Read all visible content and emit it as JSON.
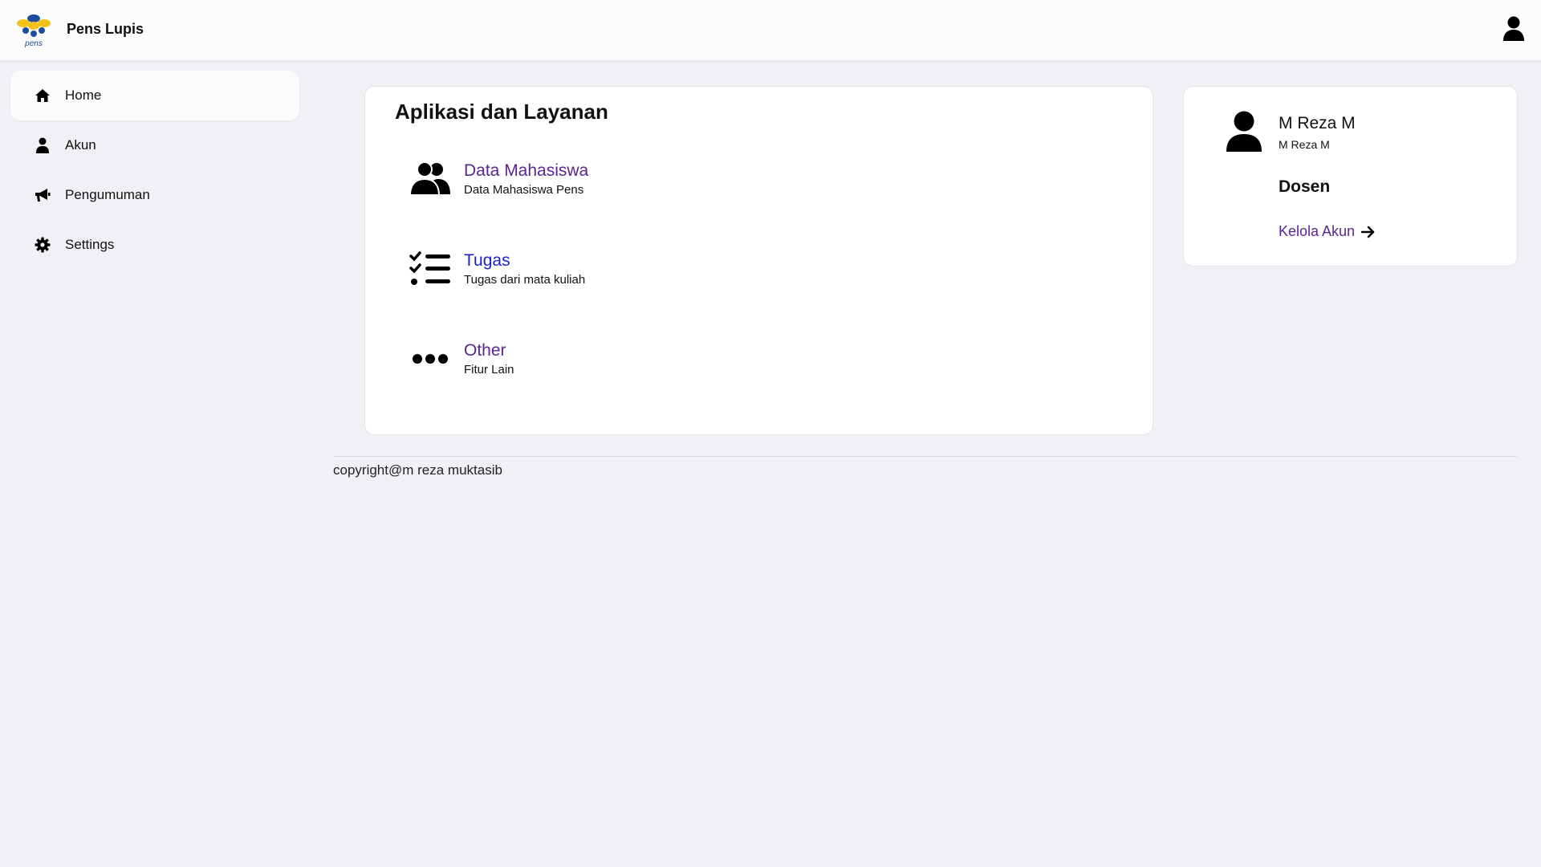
{
  "header": {
    "brand": "Pens Lupis",
    "logo_text": "pens"
  },
  "sidebar": {
    "items": [
      {
        "label": "Home",
        "icon": "home-icon",
        "active": true
      },
      {
        "label": "Akun",
        "icon": "user-icon",
        "active": false
      },
      {
        "label": "Pengumuman",
        "icon": "megaphone-icon",
        "active": false
      },
      {
        "label": "Settings",
        "icon": "gear-icon",
        "active": false
      }
    ]
  },
  "main": {
    "title": "Aplikasi dan Layanan",
    "apps": [
      {
        "name": "Data Mahasiswa",
        "desc": "Data Mahasiswa Pens",
        "icon": "users-icon",
        "color": "#5b2590"
      },
      {
        "name": "Tugas",
        "desc": "Tugas dari mata kuliah",
        "icon": "tasks-list-icon",
        "color": "#1a1fd0"
      },
      {
        "name": "Other",
        "desc": "Fitur Lain",
        "icon": "ellipsis-icon",
        "color": "#5b2590"
      }
    ]
  },
  "profile": {
    "name": "M Reza M",
    "username": "M Reza M",
    "role": "Dosen",
    "manage_link": "Kelola Akun"
  },
  "footer": {
    "copyright": "copyright@m reza muktasib"
  },
  "colors": {
    "background": "#f0f1f5",
    "link_purple": "#5b2590",
    "link_blue": "#1a1fd0",
    "logo_blue": "#1e4d9b",
    "logo_yellow": "#f2c21a"
  }
}
